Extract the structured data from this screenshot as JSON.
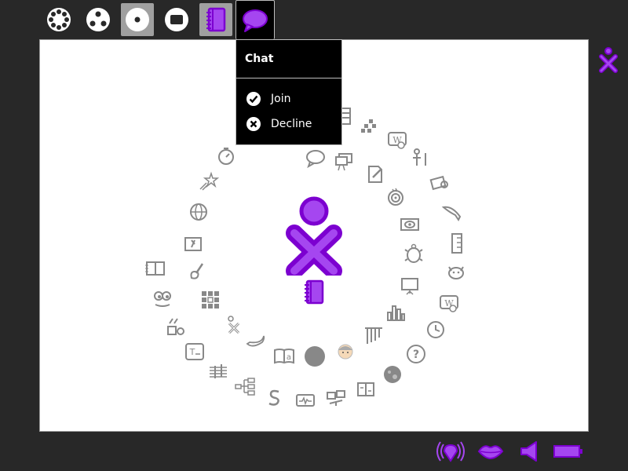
{
  "colors": {
    "frame": "#282828",
    "accent_fill": "#a546f0",
    "accent_stroke": "#7c00d0",
    "canvas": "#ffffff",
    "icon_gray": "#888888"
  },
  "top_zones": [
    {
      "name": "neighborhood-view",
      "icon": "neighborhood-icon"
    },
    {
      "name": "group-view",
      "icon": "group-icon"
    },
    {
      "name": "home-view",
      "icon": "home-icon",
      "selected": true
    },
    {
      "name": "activity-view",
      "icon": "activity-icon"
    },
    {
      "name": "journal-activity",
      "icon": "journal-icon",
      "selected": true
    },
    {
      "name": "chat-invite",
      "icon": "chat-bubble-icon",
      "open": true
    }
  ],
  "palette": {
    "title": "Chat",
    "items": [
      {
        "label": "Join",
        "icon": "check-circle-icon"
      },
      {
        "label": "Decline",
        "icon": "x-circle-icon"
      }
    ]
  },
  "home": {
    "center": "xo-buddy-icon",
    "journal": "journal-icon"
  },
  "bottom_devices": [
    {
      "name": "network-device",
      "icon": "wireless-icon"
    },
    {
      "name": "microphone-device",
      "icon": "lips-icon"
    },
    {
      "name": "speaker-device",
      "icon": "speaker-icon"
    },
    {
      "name": "battery-device",
      "icon": "battery-icon"
    }
  ]
}
